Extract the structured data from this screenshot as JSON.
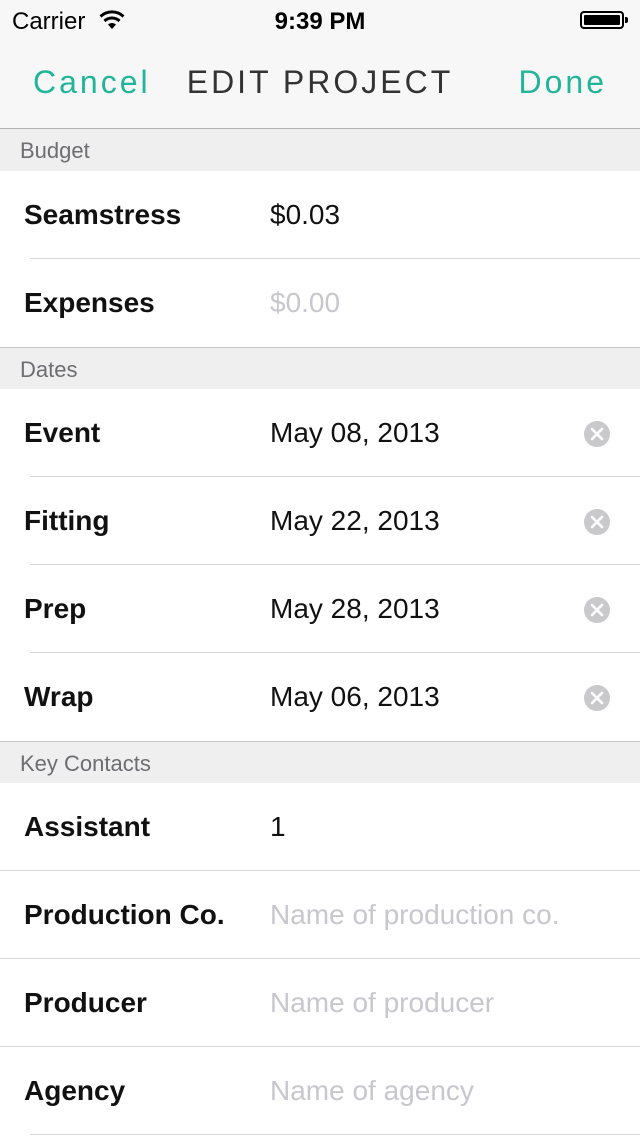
{
  "status_bar": {
    "carrier": "Carrier",
    "time": "9:39 PM",
    "battery_icon": "battery-full-icon",
    "wifi_icon": "wifi-icon"
  },
  "nav": {
    "cancel_label": "Cancel",
    "title": "EDIT PROJECT",
    "done_label": "Done",
    "accent_color": "#21b59a"
  },
  "sections": {
    "budget": {
      "header": "Budget",
      "rows": [
        {
          "label": "Seamstress",
          "value": "$0.03"
        },
        {
          "label": "Expenses",
          "placeholder": "$0.00"
        }
      ]
    },
    "dates": {
      "header": "Dates",
      "rows": [
        {
          "label": "Event",
          "value": "May 08, 2013"
        },
        {
          "label": "Fitting",
          "value": "May 22, 2013"
        },
        {
          "label": "Prep",
          "value": "May 28, 2013"
        },
        {
          "label": "Wrap",
          "value": "May 06, 2013"
        }
      ],
      "clear_icon": "clear-x-circle-icon"
    },
    "contacts": {
      "header": "Key Contacts",
      "rows": [
        {
          "label": "Assistant",
          "value": "1"
        },
        {
          "label": "Production Co.",
          "placeholder": "Name of production co."
        },
        {
          "label": "Producer",
          "placeholder": "Name of producer"
        },
        {
          "label": "Agency",
          "placeholder": "Name of agency"
        }
      ]
    }
  }
}
